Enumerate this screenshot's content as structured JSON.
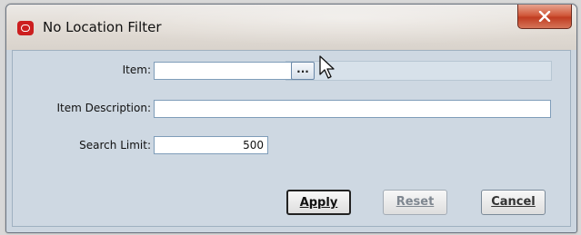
{
  "window": {
    "title": "No Location Filter",
    "close_label": "X"
  },
  "form": {
    "item": {
      "label": "Item:",
      "value": "",
      "browse_label": "..."
    },
    "item_description": {
      "label": "Item Description:",
      "value": ""
    },
    "search_limit": {
      "label": "Search Limit:",
      "value": "500"
    }
  },
  "buttons": {
    "apply": "Apply",
    "reset": "Reset",
    "cancel": "Cancel"
  },
  "colors": {
    "accent": "#cc1f1f",
    "close_button": "#c03d22"
  }
}
